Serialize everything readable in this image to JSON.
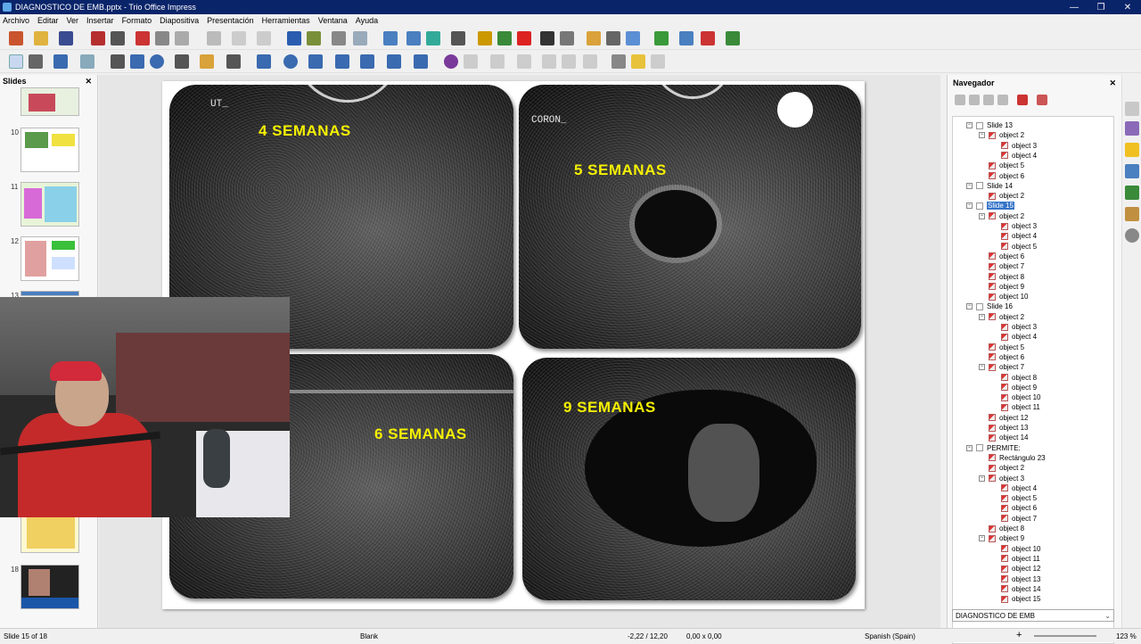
{
  "window": {
    "title": "DIAGNOSTICO DE EMB.pptx - Trio Office Impress",
    "minimize": "—",
    "maximize": "❐",
    "close": "✕"
  },
  "menu": [
    "Archivo",
    "Editar",
    "Ver",
    "Insertar",
    "Formato",
    "Diapositiva",
    "Presentación",
    "Herramientas",
    "Ventana",
    "Ayuda"
  ],
  "slides_panel": {
    "title": "Slides",
    "close": "✕",
    "numbers": [
      "10",
      "11",
      "12",
      "13",
      "18"
    ]
  },
  "slide": {
    "panels": [
      {
        "label": "4 SEMANAS",
        "tag": "UT_"
      },
      {
        "label": "5 SEMANAS",
        "tag": "CORON_"
      },
      {
        "label": "6 SEMANAS",
        "tag": ""
      },
      {
        "label": "9 SEMANAS",
        "tag": ""
      }
    ]
  },
  "navigator": {
    "title": "Navegador",
    "close": "✕",
    "tree": [
      {
        "label": "Slide 13",
        "level": 0,
        "kind": "slide",
        "exp": "−"
      },
      {
        "label": "object 2",
        "level": 1,
        "kind": "obj",
        "exp": "−"
      },
      {
        "label": "object 3",
        "level": 2,
        "kind": "obj"
      },
      {
        "label": "object 4",
        "level": 2,
        "kind": "obj"
      },
      {
        "label": "object 5",
        "level": 1,
        "kind": "obj"
      },
      {
        "label": "object 6",
        "level": 1,
        "kind": "obj"
      },
      {
        "label": "Slide 14",
        "level": 0,
        "kind": "slide",
        "exp": "−"
      },
      {
        "label": "object 2",
        "level": 1,
        "kind": "obj"
      },
      {
        "label": "Slide 15",
        "level": 0,
        "kind": "slide",
        "exp": "−",
        "selected": true
      },
      {
        "label": "object 2",
        "level": 1,
        "kind": "obj",
        "exp": "−"
      },
      {
        "label": "object 3",
        "level": 2,
        "kind": "obj"
      },
      {
        "label": "object 4",
        "level": 2,
        "kind": "obj"
      },
      {
        "label": "object 5",
        "level": 2,
        "kind": "obj"
      },
      {
        "label": "object 6",
        "level": 1,
        "kind": "obj"
      },
      {
        "label": "object 7",
        "level": 1,
        "kind": "obj"
      },
      {
        "label": "object 8",
        "level": 1,
        "kind": "obj"
      },
      {
        "label": "object 9",
        "level": 1,
        "kind": "obj"
      },
      {
        "label": "object 10",
        "level": 1,
        "kind": "obj"
      },
      {
        "label": "Slide 16",
        "level": 0,
        "kind": "slide",
        "exp": "−"
      },
      {
        "label": "object 2",
        "level": 1,
        "kind": "obj",
        "exp": "−"
      },
      {
        "label": "object 3",
        "level": 2,
        "kind": "obj"
      },
      {
        "label": "object 4",
        "level": 2,
        "kind": "obj"
      },
      {
        "label": "object 5",
        "level": 1,
        "kind": "obj"
      },
      {
        "label": "object 6",
        "level": 1,
        "kind": "obj"
      },
      {
        "label": "object 7",
        "level": 1,
        "kind": "obj",
        "exp": "−"
      },
      {
        "label": "object 8",
        "level": 2,
        "kind": "obj"
      },
      {
        "label": "object 9",
        "level": 2,
        "kind": "obj"
      },
      {
        "label": "object 10",
        "level": 2,
        "kind": "obj"
      },
      {
        "label": "object 11",
        "level": 2,
        "kind": "obj"
      },
      {
        "label": "object 12",
        "level": 1,
        "kind": "obj"
      },
      {
        "label": "object 13",
        "level": 1,
        "kind": "obj"
      },
      {
        "label": "object 14",
        "level": 1,
        "kind": "obj"
      },
      {
        "label": "PERMITE:",
        "level": 0,
        "kind": "slide",
        "exp": "−"
      },
      {
        "label": "Rectángulo 23",
        "level": 1,
        "kind": "obj"
      },
      {
        "label": "object 2",
        "level": 1,
        "kind": "obj"
      },
      {
        "label": "object 3",
        "level": 1,
        "kind": "obj",
        "exp": "−"
      },
      {
        "label": "object 4",
        "level": 2,
        "kind": "obj"
      },
      {
        "label": "object 5",
        "level": 2,
        "kind": "obj"
      },
      {
        "label": "object 6",
        "level": 2,
        "kind": "obj"
      },
      {
        "label": "object 7",
        "level": 2,
        "kind": "obj"
      },
      {
        "label": "object 8",
        "level": 1,
        "kind": "obj"
      },
      {
        "label": "object 9",
        "level": 1,
        "kind": "obj",
        "exp": "−"
      },
      {
        "label": "object 10",
        "level": 2,
        "kind": "obj"
      },
      {
        "label": "object 11",
        "level": 2,
        "kind": "obj"
      },
      {
        "label": "object 12",
        "level": 2,
        "kind": "obj"
      },
      {
        "label": "object 13",
        "level": 2,
        "kind": "obj"
      },
      {
        "label": "object 14",
        "level": 2,
        "kind": "obj"
      },
      {
        "label": "object 15",
        "level": 2,
        "kind": "obj"
      }
    ],
    "document_select": "DIAGNOSTICO DE EMB"
  },
  "status": {
    "slide_pos": "Slide 15 of 18",
    "layout": "Blank",
    "position": "-2,22 / 12,20",
    "size": "0,00 x 0,00",
    "language": "Spanish (Spain)",
    "zoom": "123 %"
  }
}
